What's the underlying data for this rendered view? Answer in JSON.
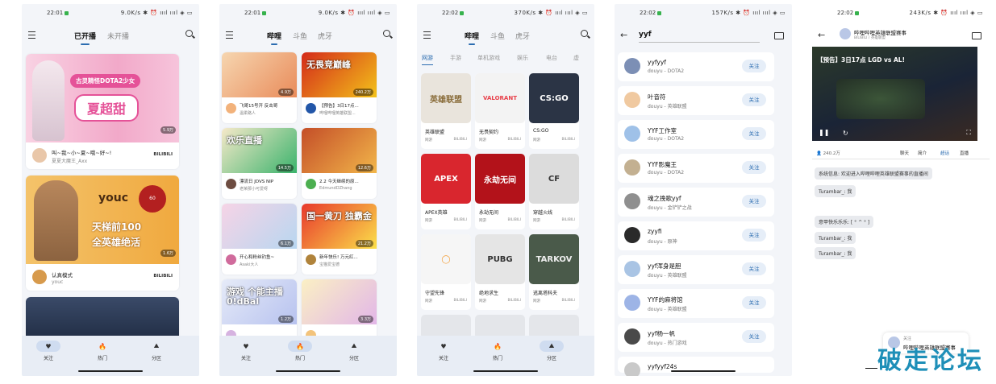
{
  "phone1": {
    "status": {
      "time": "22:01",
      "right": "9.0K/s ✱ ⏰ ıııl ıııl ◈ ▭"
    },
    "tabs": [
      "已开播",
      "未开播"
    ],
    "cards": [
      {
        "title": "叫~我~小~夏~哦~好~!",
        "streamer": "夏夏大魔王_Axx",
        "platform": "BILIBILI",
        "views": "5.9万",
        "thumb_text1": "古灵精怪DOTA2少女",
        "thumb_text2": "夏超甜"
      },
      {
        "title": "认真模式",
        "streamer": "youc",
        "platform": "BILIBILI",
        "views": "1.6万",
        "thumb_text1": "youc",
        "thumb_text2": "天梯前100",
        "thumb_text3": "全英雄绝活",
        "badge": "60"
      }
    ],
    "nav": [
      "关注",
      "热门",
      "分区"
    ]
  },
  "phone2": {
    "status": {
      "time": "22:01",
      "right": "9.0K/s ✱ ⏰ ıııl ıııl ◈ ▭"
    },
    "tabs": [
      "哔哩",
      "斗鱼",
      "虎牙"
    ],
    "cards": [
      {
        "title": "飞哥15号开 反击哥",
        "streamer": "温柔路人",
        "views": "4.9万",
        "thumb_text": ""
      },
      {
        "title": "【预告】3日17点...",
        "streamer": "哔哩哔哩英雄联盟...",
        "views": "240.2万",
        "thumb_text": "无畏竞巅峰"
      },
      {
        "title": "漂流日 JDVS NIP",
        "streamer": "老荣那小可爱呀",
        "views": "14.5万",
        "thumb_text": "欢乐直播"
      },
      {
        "title": "2.2 今天继续的原...",
        "streamer": "EdmundDZhang",
        "views": "12.6万",
        "thumb_text": ""
      },
      {
        "title": "开心和粉丝钓鱼~",
        "streamer": "Asaki大人",
        "views": "6.1万",
        "thumb_text": ""
      },
      {
        "title": "新年快乐! 万元红...",
        "streamer": "宝猫爱宝德",
        "views": "21.2万",
        "thumb_text": "国一黄刀 独霸金"
      },
      {
        "title": "",
        "streamer": "",
        "views": "1.2万",
        "thumb_text": "游戏 个能主播 0!dBal"
      },
      {
        "title": "",
        "streamer": "",
        "views": "3.3万",
        "thumb_text": ""
      }
    ],
    "nav": [
      "关注",
      "热门",
      "分区"
    ]
  },
  "phone3": {
    "status": {
      "time": "22:02",
      "right": "370K/s ✱ ⏰ ıııl ıııl ◈ ▭"
    },
    "tabs": [
      "哔哩",
      "斗鱼",
      "虎牙"
    ],
    "categories": [
      "网游",
      "手游",
      "单机游戏",
      "娱乐",
      "电台",
      "虚"
    ],
    "games": [
      {
        "name": "英雄联盟",
        "type": "网游",
        "plat": "BILIBILI",
        "logo": "英雄联盟",
        "bg": "#e9e4dc",
        "fg": "#8a6d3b"
      },
      {
        "name": "无畏契约",
        "type": "网游",
        "plat": "BILIBILI",
        "logo": "VALORANT",
        "bg": "#f3f3f3",
        "fg": "#e8404a"
      },
      {
        "name": "CS:GO",
        "type": "网游",
        "plat": "BILIBILI",
        "logo": "CS:GO",
        "bg": "#2b3445",
        "fg": "#ffffff"
      },
      {
        "name": "APEX英雄",
        "type": "网游",
        "plat": "BILIBILI",
        "logo": "APEX",
        "bg": "#d9262e",
        "fg": "#ffffff"
      },
      {
        "name": "永劫无间",
        "type": "网游",
        "plat": "BILIBILI",
        "logo": "永劫无间",
        "bg": "#b3121a",
        "fg": "#ffffff"
      },
      {
        "name": "穿越火线",
        "type": "网游",
        "plat": "BILIBILI",
        "logo": "CF",
        "bg": "#dcdcdc",
        "fg": "#333333"
      },
      {
        "name": "守望先锋",
        "type": "网游",
        "plat": "BILIBILI",
        "logo": "◯",
        "bg": "#f6f6f6",
        "fg": "#f39c33"
      },
      {
        "name": "绝地求生",
        "type": "网游",
        "plat": "BILIBILI",
        "logo": "PUBG",
        "bg": "#e5e5e5",
        "fg": "#333333"
      },
      {
        "name": "逃离塔科夫",
        "type": "网游",
        "plat": "BILIBILI",
        "logo": "TARKOV",
        "bg": "#4a5a4a",
        "fg": "#eeeeee"
      }
    ],
    "nav": [
      "关注",
      "热门",
      "分区"
    ]
  },
  "phone4": {
    "status": {
      "time": "22:02",
      "right": "157K/s ✱ ⏰ ıııl ıııl ◈ ▭"
    },
    "search": {
      "value": "yyf"
    },
    "results": [
      {
        "name": "yyfyyf",
        "sub": "douyu - DOTA2"
      },
      {
        "name": "叶音符",
        "sub": "douyu - 英雄联盟"
      },
      {
        "name": "YYF工作室",
        "sub": "douyu - DOTA2"
      },
      {
        "name": "YYF影魔王",
        "sub": "douyu - DOTA2"
      },
      {
        "name": "魂之挽歌yyf",
        "sub": "douyu - 金铲铲之战"
      },
      {
        "name": "zyyfi",
        "sub": "douyu - 原神"
      },
      {
        "name": "yyf浑身是胆",
        "sub": "douyu - 英雄联盟"
      },
      {
        "name": "YYF的麻将馆",
        "sub": "douyu - 英雄联盟"
      },
      {
        "name": "yyf杨一帆",
        "sub": "douyu - 热门游戏"
      },
      {
        "name": "yyfyyf24s",
        "sub": ""
      }
    ],
    "follow_label": "关注"
  },
  "phone5": {
    "status": {
      "time": "22:02",
      "right": "243K/s ✱ ⏰ ıııl ıııl ◈ ▭"
    },
    "header": {
      "title": "哔哩哔哩英雄联盟赛事",
      "sub": "BILIBILI / 英雄联盟"
    },
    "video_title": "【预告】3日17点 LGD vs AL!",
    "viewers": "240.2万",
    "tabs": [
      "聊天",
      "简介",
      "超话",
      "直播"
    ],
    "messages": [
      "系统信息: 欢迎进入哔哩哔哩英雄联盟赛事的直播间",
      "Turambar_: 我",
      "意甲快乐乐乐: [ ° ^ ° ]",
      "Turambar_: 我",
      "Turambar_: 我"
    ],
    "mini_player": {
      "top": "关注",
      "text": "哔哩哔哩英雄联盟赛事"
    }
  },
  "watermark": "破走论坛"
}
